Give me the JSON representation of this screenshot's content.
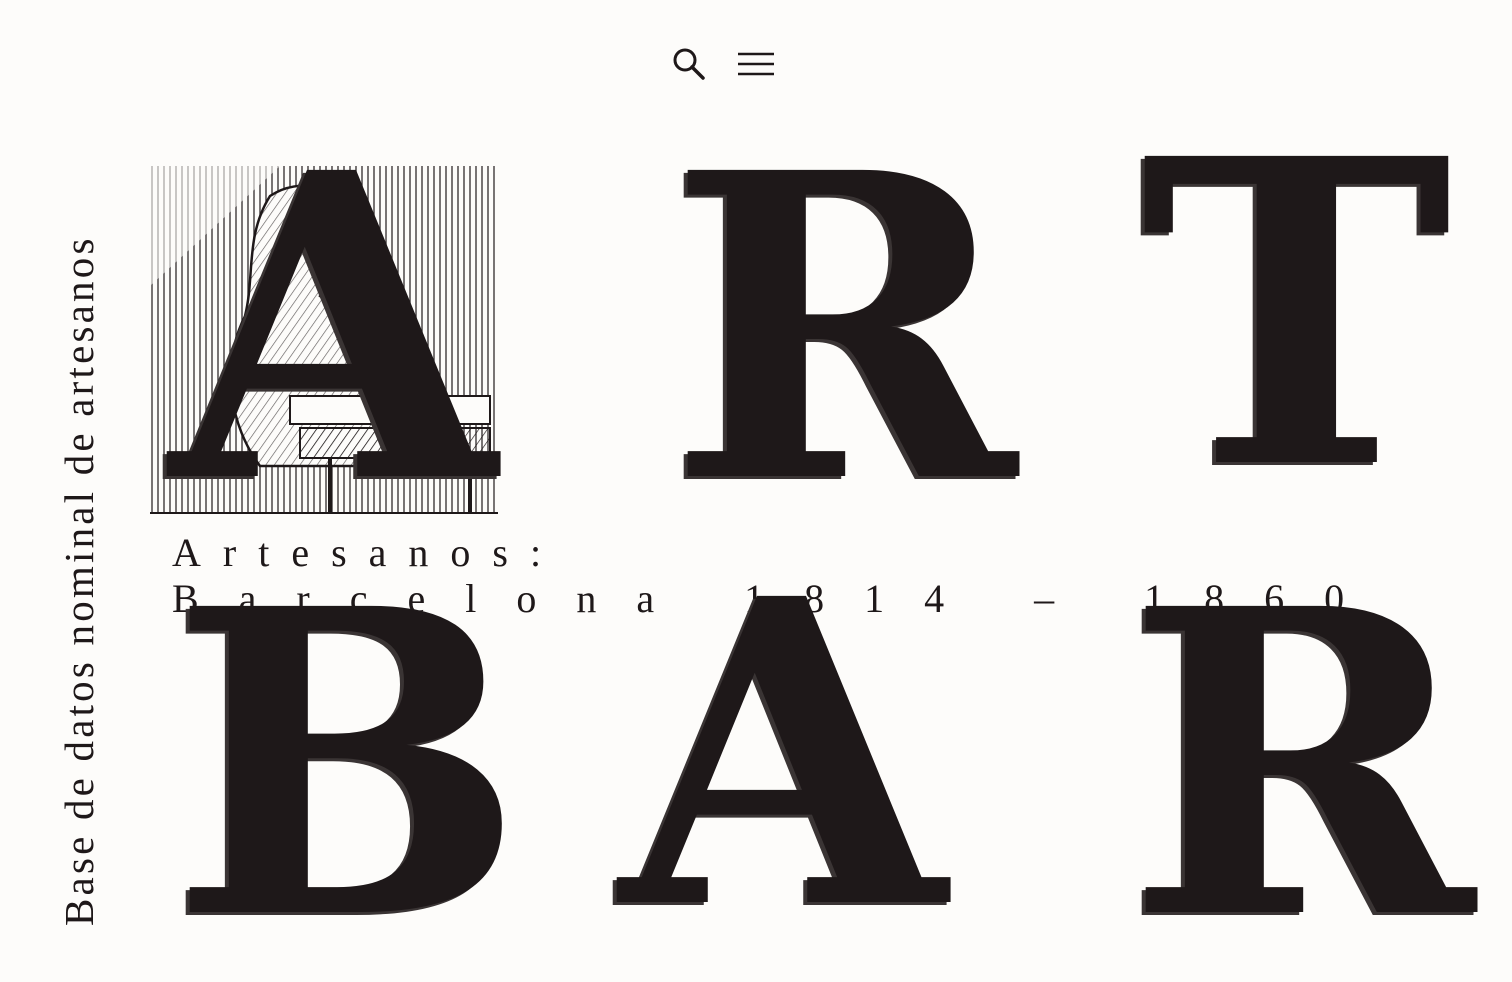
{
  "header": {
    "search_icon": "search-icon",
    "menu_icon": "hamburger-menu-icon"
  },
  "tagline": "Base de datos nominal de artesanos",
  "hero": {
    "row1": [
      "A",
      "R",
      "T"
    ],
    "row2": [
      "B",
      "A",
      "R"
    ],
    "image_icon": "artisan-engraving"
  },
  "subtitle": {
    "line1": "Artesanos:",
    "line2": "Barcelona 1814 – 1860"
  },
  "colors": {
    "background": "#fdfcfa",
    "ink": "#1e1819"
  }
}
